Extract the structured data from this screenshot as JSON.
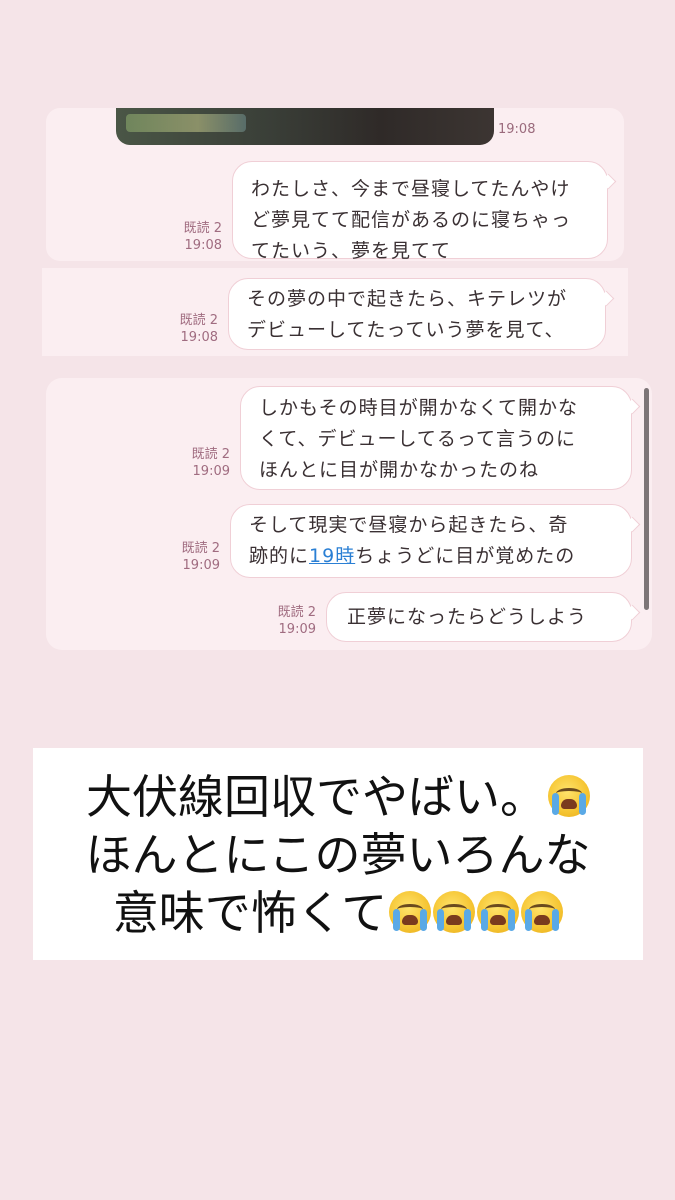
{
  "messages": [
    {
      "id": "m0",
      "read": "",
      "time": "19:08",
      "text": ""
    },
    {
      "id": "m1",
      "read": "既読 2",
      "time": "19:08",
      "lines": [
        "わたしさ、今まで昼寝してたんやけ",
        "ど夢見てて配信があるのに寝ちゃっ",
        "てたいう、夢を見てて"
      ]
    },
    {
      "id": "m2",
      "read": "既読 2",
      "time": "19:08",
      "lines": [
        "その夢の中で起きたら、キテレツが",
        "デビューしてたっていう夢を見て、"
      ]
    },
    {
      "id": "m3",
      "read": "既読 2",
      "time": "19:09",
      "lines": [
        "しかもその時目が開かなくて開かな",
        "くて、デビューしてるって言うのに",
        "ほんとに目が開かなかったのね"
      ]
    },
    {
      "id": "m4",
      "read": "既読 2",
      "time": "19:09",
      "line1": "そして現実で昼寝から起きたら、奇",
      "line2_pre": "跡的に",
      "line2_link": "19時",
      "line2_post": "ちょうどに目が覚めたの"
    },
    {
      "id": "m5",
      "read": "既読 2",
      "time": "19:09",
      "lines": [
        "正夢になったらどうしよう"
      ]
    }
  ],
  "caption": {
    "line1": "大伏線回収でやばい。",
    "line2": "ほんとにこの夢いろんな",
    "line3": "意味で怖くて",
    "emoji_name": "loudly-crying-face-emoji"
  }
}
